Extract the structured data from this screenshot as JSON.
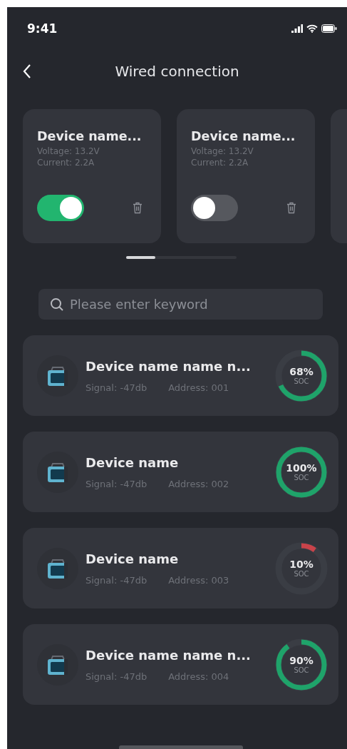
{
  "status_bar": {
    "time": "9:41"
  },
  "header": {
    "title": "Wired connection"
  },
  "connected_devices": [
    {
      "name": "Device name...",
      "voltage": "Voltage: 13.2V",
      "current": "Current: 2.2A",
      "on": true
    },
    {
      "name": "Device name...",
      "voltage": "Voltage: 13.2V",
      "current": "Current: 2.2A",
      "on": false
    }
  ],
  "search": {
    "placeholder": "Please enter keyword"
  },
  "devices": [
    {
      "name": "Device name name n...",
      "signal": "Signal: -47db",
      "address": "Address: 001",
      "soc": "68%",
      "soc_label": "SOC",
      "level": 0.68,
      "color": "#1fa36a"
    },
    {
      "name": "Device name",
      "signal": "Signal: -47db",
      "address": "Address: 002",
      "soc": "100%",
      "soc_label": "SOC",
      "level": 1,
      "color": "#1fa36a"
    },
    {
      "name": "Device name",
      "signal": "Signal: -47db",
      "address": "Address: 003",
      "soc": "10%",
      "soc_label": "SOC",
      "level": 0.1,
      "color": "#c9434a"
    },
    {
      "name": "Device name name n...",
      "signal": "Signal: -47db",
      "address": "Address: 004",
      "soc": "90%",
      "soc_label": "SOC",
      "level": 0.9,
      "color": "#1fa36a"
    }
  ]
}
